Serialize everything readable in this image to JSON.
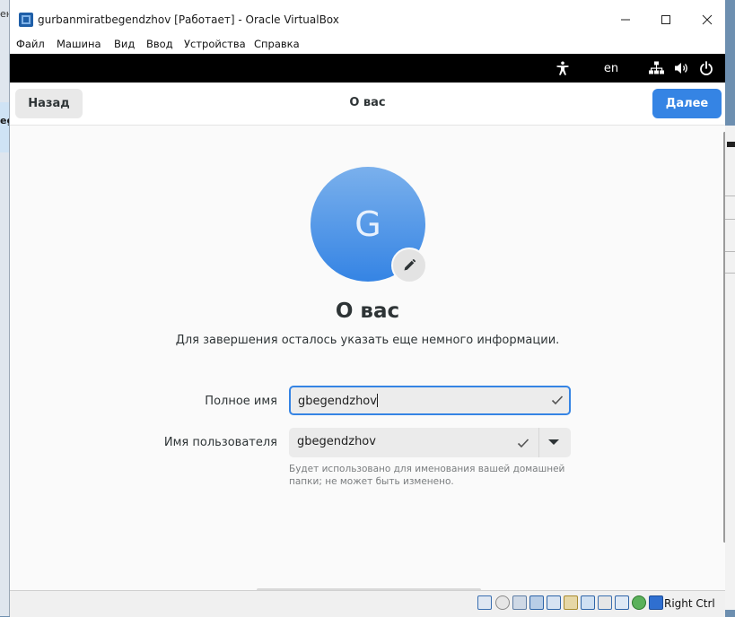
{
  "window": {
    "title": "gurbanmiratbegendzhov [Работает] - Oracle VirtualBox"
  },
  "menubar": {
    "items": [
      "Файл",
      "Машина",
      "Вид",
      "Ввод",
      "Устройства",
      "Справка"
    ]
  },
  "gnome_topbar": {
    "language": "en"
  },
  "headerbar": {
    "back_label": "Назад",
    "title": "О вас",
    "next_label": "Далее"
  },
  "page": {
    "avatar_letter": "G",
    "title": "О вас",
    "subtitle": "Для завершения осталось указать еще немного информации.",
    "full_name_label": "Полное имя",
    "full_name_value": "gbegendzhov",
    "username_label": "Имя пользователя",
    "username_value": "gbegendzhov",
    "username_hint": "Будет использовано для именования вашей домашней папки; не может быть изменено."
  },
  "statusbar": {
    "host_key": "Right Ctrl"
  },
  "desktop": {
    "left_fragment_top": "ен",
    "left_fragment_mid": "eg"
  },
  "colors": {
    "accent": "#3584e4",
    "gnome_topbar": "#000000"
  }
}
